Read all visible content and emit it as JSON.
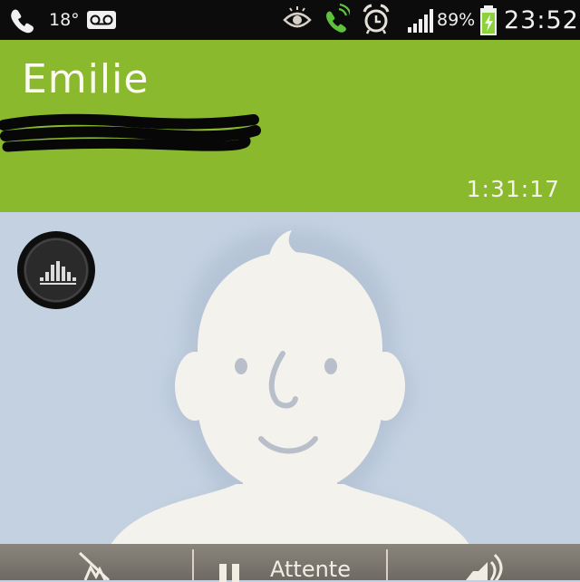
{
  "status_bar": {
    "temperature": "18°",
    "battery_percent": "89%",
    "clock": "23:52",
    "icons": [
      "phone-call-icon",
      "voicemail-icon",
      "eye-icon",
      "active-call-icon",
      "alarm-clock-icon",
      "signal-strength-icon",
      "battery-charging-icon"
    ],
    "colors": {
      "background": "#0c0c0c",
      "active_call_icon": "#5cc33a",
      "battery_icon": "#8bd23b"
    }
  },
  "call": {
    "caller_name": "Emilie",
    "duration": "1:31:17"
  },
  "contact_photo": {
    "equalizer_button_icon": "equalizer-icon",
    "placeholder": "default-avatar-icon"
  },
  "bottom_bar": {
    "hold_label": "Attente",
    "left_icon": "mute-microphone-icon",
    "right_icon": "speaker-icon",
    "hold_icon": "pause-icon"
  },
  "colors": {
    "header": "#8ab92d",
    "photo_background": "#c3d1e1",
    "bottom_bar": "#7d786f"
  }
}
